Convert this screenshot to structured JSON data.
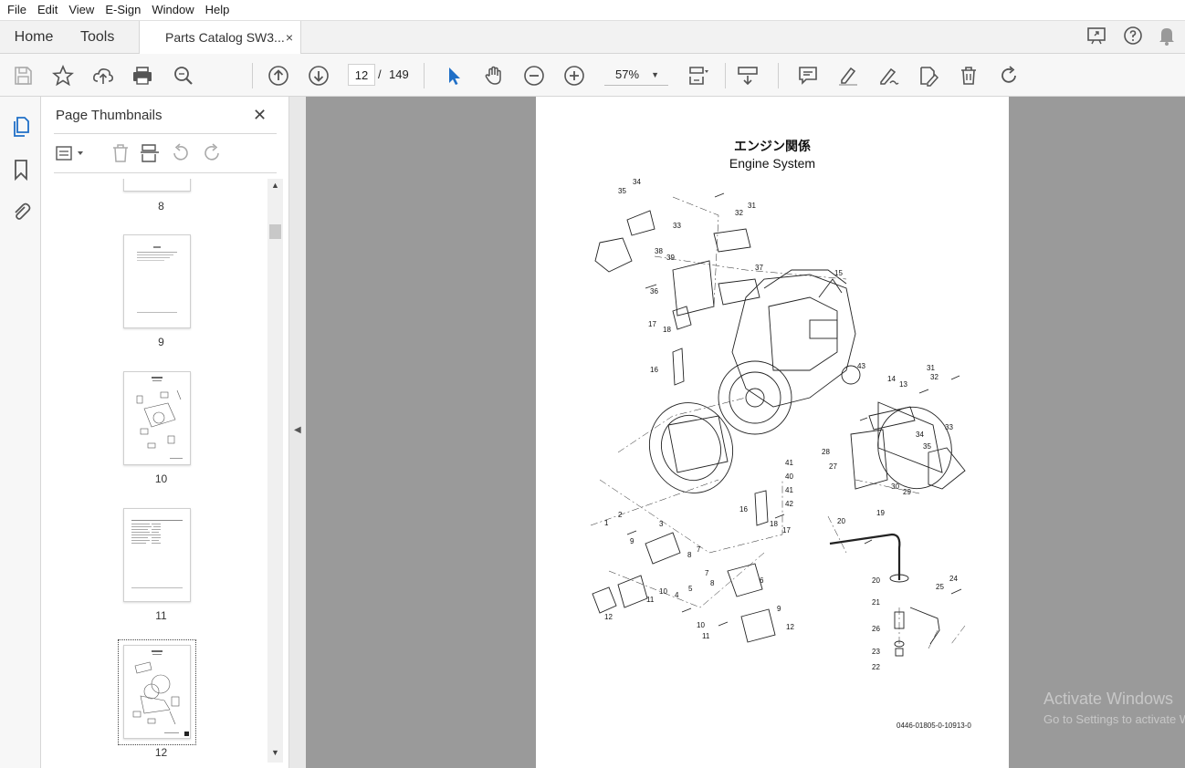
{
  "menu": [
    "File",
    "Edit",
    "View",
    "E-Sign",
    "Window",
    "Help"
  ],
  "tabs": {
    "home": "Home",
    "tools": "Tools",
    "document": "Parts Catalog SW3...",
    "close": "×"
  },
  "toolbar": {
    "current_page": "12",
    "page_separator": "/",
    "total_pages": "149",
    "zoom": "57%"
  },
  "icons": [
    "save-icon",
    "star-icon",
    "upload-icon",
    "print-icon",
    "search-zoom-icon",
    "page-up-icon",
    "page-down-icon",
    "cursor-icon",
    "hand-icon",
    "zoom-out-icon",
    "zoom-in-icon",
    "fit-page-icon",
    "scroll-mode-icon",
    "comment-icon",
    "highlight-icon",
    "sign-icon",
    "edit-icon",
    "delete-icon",
    "rotate-icon",
    "share-icon",
    "help-icon",
    "bell-icon"
  ],
  "sidebar": {
    "title": "Page Thumbnails",
    "close": "✕",
    "thumbnails": [
      {
        "label": "8"
      },
      {
        "label": "9"
      },
      {
        "label": "10"
      },
      {
        "label": "11"
      },
      {
        "label": "12",
        "selected": true
      }
    ]
  },
  "page": {
    "title_jp": "エンジン関係",
    "title_en": "Engine System",
    "code": "0446-01805-0-10913-0",
    "callouts": [
      "34",
      "35",
      "33",
      "32",
      "31",
      "38",
      "39",
      "37",
      "15",
      "36",
      "17",
      "18",
      "16",
      "43",
      "14",
      "13",
      "31",
      "32",
      "34",
      "35",
      "33",
      "28",
      "27",
      "30",
      "29",
      "41",
      "40",
      "41",
      "42",
      "16",
      "18",
      "17",
      "20",
      "19",
      "1",
      "2",
      "3",
      "9",
      "8",
      "7",
      "12",
      "11",
      "10",
      "7",
      "8",
      "6",
      "4",
      "5",
      "9",
      "10",
      "11",
      "12",
      "20",
      "21",
      "26",
      "23",
      "22",
      "25",
      "24"
    ]
  },
  "watermark": {
    "line1": "Activate Windows",
    "line2": "Go to Settings to activate Windows."
  }
}
